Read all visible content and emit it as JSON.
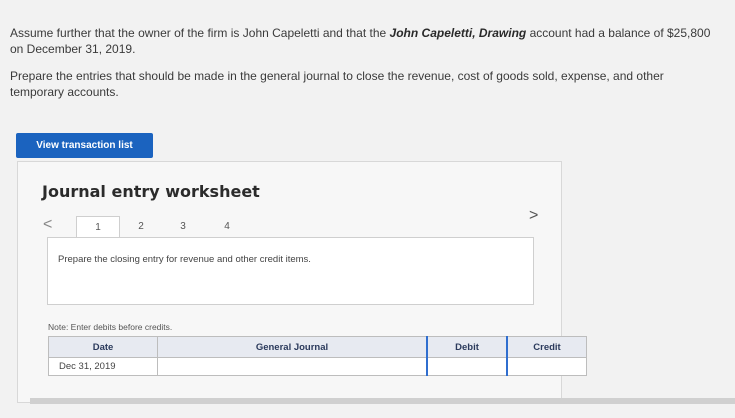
{
  "intro": {
    "p1_part1": "Assume further that the owner of the firm is John Capeletti and that the ",
    "p1_bold": "John Capeletti, Drawing",
    "p1_part2": " account had a balance of $25,800 on December 31, 2019.",
    "p2": "Prepare the entries that should be made in the general journal to close the revenue, cost of goods sold, expense, and other temporary accounts."
  },
  "buttons": {
    "view_transactions": "View transaction list"
  },
  "worksheet": {
    "title": "Journal entry worksheet",
    "prev_arrow": "<",
    "next_arrow": ">",
    "tabs": [
      "1",
      "2",
      "3",
      "4"
    ],
    "active_tab": "1",
    "instruction": "Prepare the closing entry for revenue and other credit items.",
    "note": "Note: Enter debits before credits."
  },
  "journal": {
    "headers": {
      "date": "Date",
      "general_journal": "General Journal",
      "debit": "Debit",
      "credit": "Credit"
    },
    "rows": [
      {
        "date": "Dec 31, 2019",
        "account": "",
        "debit": "",
        "credit": ""
      }
    ]
  },
  "colors": {
    "primary_button": "#1b63bf",
    "header_bg": "#e7eaf1",
    "input_accent": "#2f6ecf"
  }
}
